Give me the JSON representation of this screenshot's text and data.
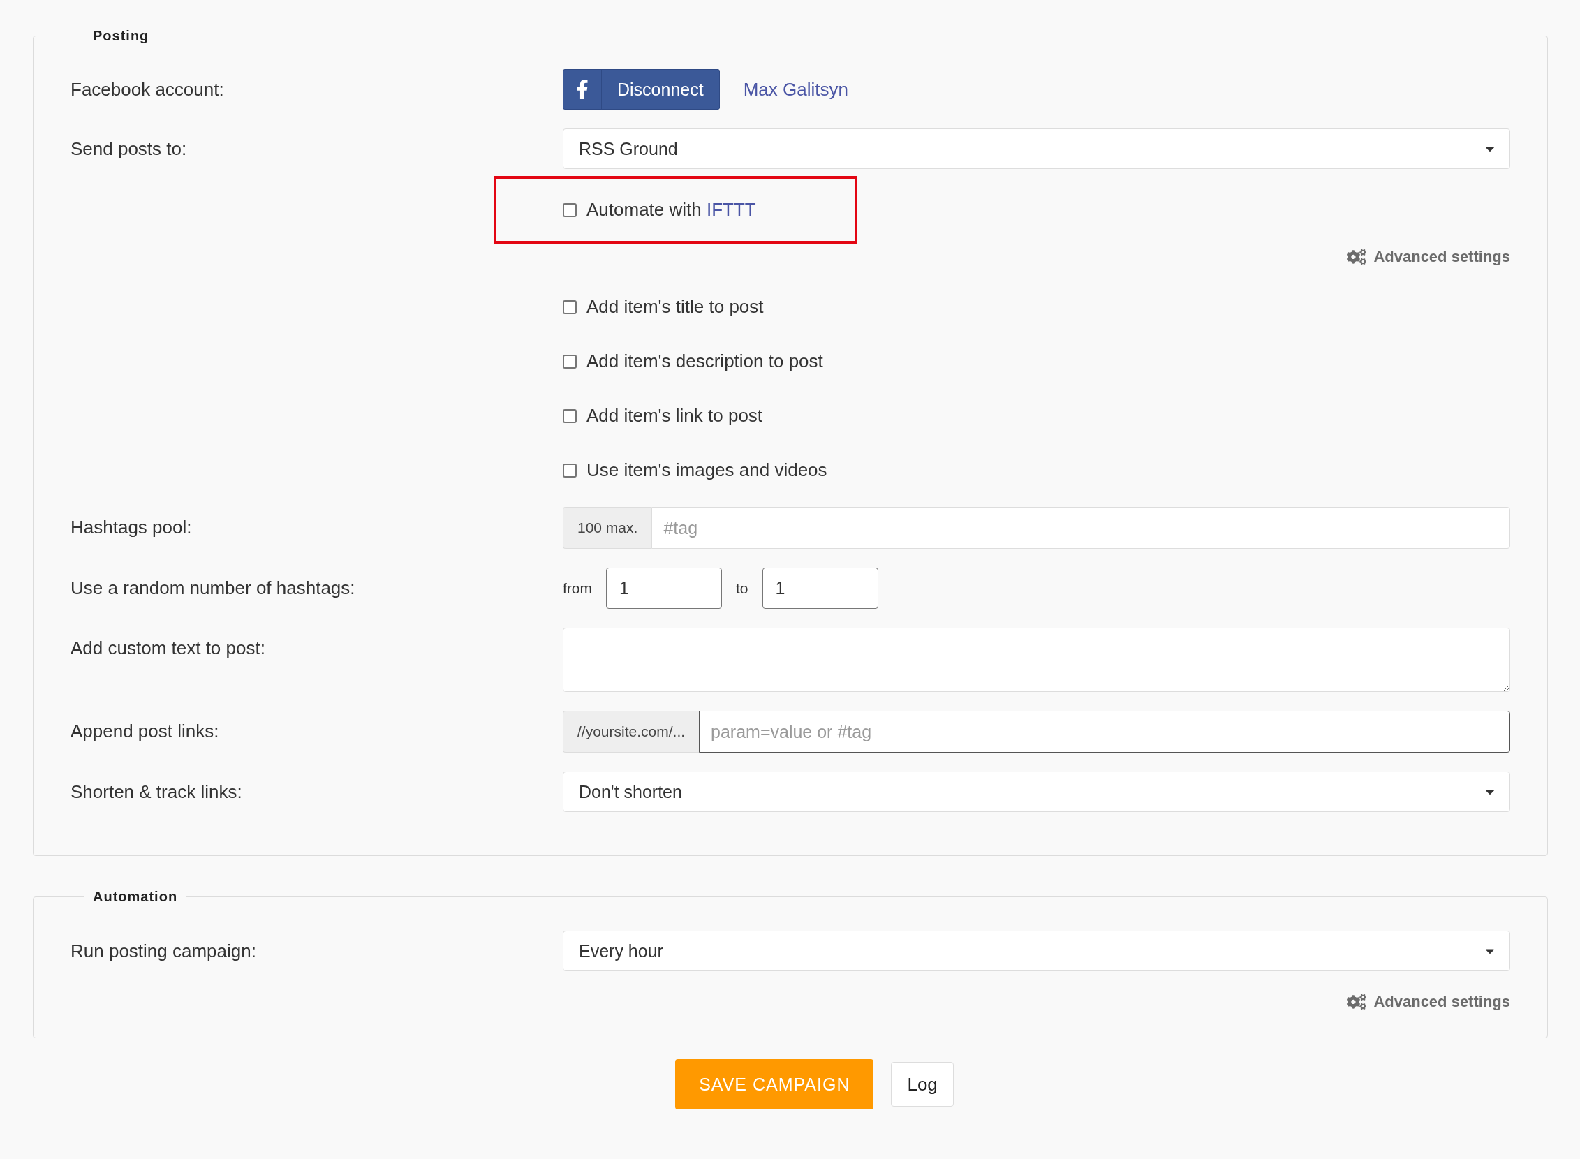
{
  "sections": [
    {
      "legend": "Posting",
      "rows": [
        {
          "kind": "account",
          "label": "Facebook account:",
          "button": "Disconnect",
          "account_name": "Max Galitsyn"
        },
        {
          "kind": "select",
          "label": "Send posts to:",
          "value": "RSS Ground"
        },
        {
          "kind": "checkbox",
          "text": "Automate with ",
          "link": "IFTTT",
          "checked": false,
          "highlighted": true
        },
        {
          "kind": "advanced",
          "text": "Advanced settings"
        },
        {
          "kind": "checkbox",
          "text": "Add item's title to post",
          "checked": false,
          "highlighted": false
        },
        {
          "kind": "checkbox",
          "text": "Add item's description to post",
          "checked": false,
          "highlighted": false
        },
        {
          "kind": "checkbox",
          "text": "Add item's link to post",
          "checked": false,
          "highlighted": false
        },
        {
          "kind": "checkbox",
          "text": "Use item's images and videos",
          "checked": false,
          "highlighted": false
        },
        {
          "kind": "addon_input",
          "label": "Hashtags pool:",
          "addon": "100 max.",
          "placeholder": "#tag",
          "focused": false
        },
        {
          "kind": "range",
          "label": "Use a random number of hashtags:",
          "from_label": "from",
          "from_value": "1",
          "to_label": "to",
          "to_value": "1"
        },
        {
          "kind": "textarea",
          "label": "Add custom text to post:"
        },
        {
          "kind": "addon_input",
          "label": "Append post links:",
          "addon": "//yoursite.com/...",
          "placeholder": "param=value or #tag",
          "focused": true
        },
        {
          "kind": "select",
          "label": "Shorten & track links:",
          "value": "Don't shorten"
        }
      ]
    },
    {
      "legend": "Automation",
      "rows": [
        {
          "kind": "select",
          "label": "Run posting campaign:",
          "value": "Every hour"
        },
        {
          "kind": "advanced",
          "text": "Advanced settings"
        }
      ]
    }
  ],
  "buttons": [
    {
      "kind": "primary",
      "label": "SAVE CAMPAIGN"
    },
    {
      "kind": "secondary",
      "label": "Log"
    }
  ]
}
